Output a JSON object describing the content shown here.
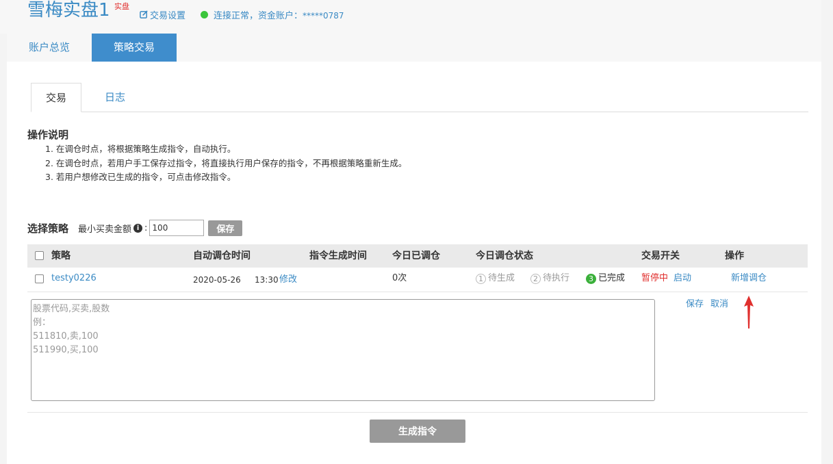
{
  "header": {
    "title": "雪梅实盘1",
    "badge": "实盘",
    "settings_label": "交易设置",
    "status_text": "连接正常，资金账户：",
    "account_masked": "*****0787",
    "status_color": "#3bc53b"
  },
  "main_tabs": [
    {
      "label": "账户总览"
    },
    {
      "label": "策略交易"
    }
  ],
  "sub_tabs": [
    {
      "label": "交易"
    },
    {
      "label": "日志"
    }
  ],
  "instructions": {
    "title": "操作说明",
    "items": [
      "1. 在调仓时点，将根据策略生成指令，自动执行。",
      "2. 在调仓时点，若用户手工保存过指令，将直接执行用户保存的指令，不再根据策略重新生成。",
      "3. 若用户想修改已生成的指令，可点击修改指令。"
    ]
  },
  "strategy_select": {
    "title": "选择策略",
    "min_amount_label": "最小买卖金额",
    "colon": ":",
    "min_amount_value": "100",
    "save_label": "保存"
  },
  "table": {
    "headers": [
      "策略",
      "自动调仓时间",
      "指令生成时间",
      "今日已调仓",
      "今日调仓状态",
      "交易开关",
      "操作"
    ],
    "rows": [
      {
        "strategy": "testy0226",
        "auto_date": "2020-05-26",
        "auto_time": "13:30",
        "modify": "修改",
        "gen_time": "",
        "today_count": "0次",
        "status_steps": [
          {
            "num": "1",
            "label": "待生成"
          },
          {
            "num": "2",
            "label": "待执行"
          },
          {
            "num": "3",
            "label": "已完成"
          }
        ],
        "switch_state": "暂停中",
        "switch_action": "启动",
        "operation": "新增调仓"
      }
    ]
  },
  "orders_editor": {
    "placeholder": "股票代码,买卖,股数\n例：\n511810,卖,100\n511990,买,100",
    "save_label": "保存",
    "cancel_label": "取消"
  },
  "generate_button": "生成指令",
  "colors": {
    "accent": "#3f8dcc",
    "link": "#3a8ac4",
    "danger": "#e0302e",
    "success": "#3bb03b"
  }
}
